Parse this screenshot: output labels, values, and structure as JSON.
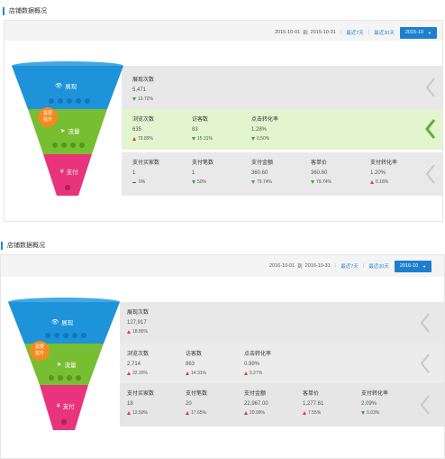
{
  "colors": {
    "accent": "#1e7fd0",
    "blue_stage": "#1f93d9",
    "green_stage": "#78be32",
    "pink_stage": "#e8347c",
    "badge": "#f58a1f",
    "up": "#e23d3d",
    "down": "#3aa63a"
  },
  "panels": [
    {
      "title": "店铺数据概况",
      "date_from": "2015-10-01",
      "date_to_sep": "到",
      "date_to": "2015-10-31",
      "last7": "最近7天",
      "last30": "最近30天",
      "month": "2015-10",
      "funnel": {
        "stage1": "展现",
        "stage2": "流量",
        "stage3": "支付",
        "badge": "需要\n提升"
      },
      "row1": [
        {
          "label": "展现次数",
          "value": "5,471",
          "change": "13.72%",
          "dir": "down"
        }
      ],
      "row2": [
        {
          "label": "浏览次数",
          "value": "635",
          "change": "79.89%",
          "dir": "up"
        },
        {
          "label": "访客数",
          "value": "83",
          "change": "15.31%",
          "dir": "down"
        },
        {
          "label": "点击转化率",
          "value": "1.28%",
          "change": "0.50%",
          "dir": "down"
        }
      ],
      "row3": [
        {
          "label": "支付买家数",
          "value": "1",
          "change": "0%",
          "dir": "flat"
        },
        {
          "label": "支付笔数",
          "value": "1",
          "change": "50%",
          "dir": "down"
        },
        {
          "label": "支付金额",
          "value": "360.60",
          "change": "79.74%",
          "dir": "down"
        },
        {
          "label": "客单价",
          "value": "360.60",
          "change": "79.74%",
          "dir": "down"
        },
        {
          "label": "支付转化率",
          "value": "1.20%",
          "change": "0.18%",
          "dir": "up"
        }
      ]
    },
    {
      "title": "店铺数据概况",
      "date_from": "2016-10-01",
      "date_to_sep": "到",
      "date_to": "2016-10-31",
      "last7": "最近7天",
      "last30": "最近30天",
      "month": "2016-10",
      "funnel": {
        "stage1": "展现",
        "stage2": "流量",
        "stage3": "支付",
        "badge": "需要\n提升"
      },
      "row1": [
        {
          "label": "展现次数",
          "value": "127,917",
          "change": "18.86%",
          "dir": "up"
        }
      ],
      "row2": [
        {
          "label": "浏览次数",
          "value": "2,714",
          "change": "32.20%",
          "dir": "up"
        },
        {
          "label": "访客数",
          "value": "863",
          "change": "14.31%",
          "dir": "up"
        },
        {
          "label": "点击转化率",
          "value": "0.99%",
          "change": "9.27%",
          "dir": "up"
        }
      ],
      "row3": [
        {
          "label": "支付买家数",
          "value": "18",
          "change": "12.50%",
          "dir": "up"
        },
        {
          "label": "支付笔数",
          "value": "20",
          "change": "17.65%",
          "dir": "up"
        },
        {
          "label": "支付金额",
          "value": "22,967.00",
          "change": "20.99%",
          "dir": "up"
        },
        {
          "label": "客单价",
          "value": "1,277.61",
          "change": "7.55%",
          "dir": "up"
        },
        {
          "label": "支付转化率",
          "value": "2.09%",
          "change": "0.03%",
          "dir": "down"
        }
      ]
    }
  ]
}
